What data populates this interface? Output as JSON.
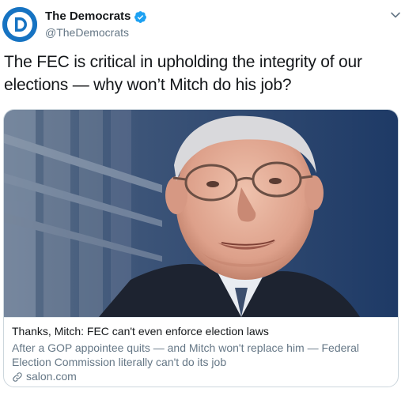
{
  "tweet": {
    "author": {
      "display_name": "The Democrats",
      "handle": "@TheDemocrats",
      "verified": true,
      "avatar_icon": "democrats-d-logo-icon",
      "avatar_color": "#1673c2"
    },
    "text": "The FEC is critical in upholding the integrity of our elections — why won’t Mitch do his job?",
    "card": {
      "image_icon": "card-photo",
      "title": "Thanks, Mitch: FEC can't even enforce election laws",
      "description": "After a GOP appointee quits — and Mitch won't replace him — Federal Election Commission literally can't do its job",
      "domain": "salon.com",
      "domain_icon": "link-icon"
    },
    "menu_icon": "chevron-down-icon"
  },
  "colors": {
    "verified_badge": "#1da1f2",
    "secondary_text": "#657786",
    "border": "#ccd6dd"
  }
}
